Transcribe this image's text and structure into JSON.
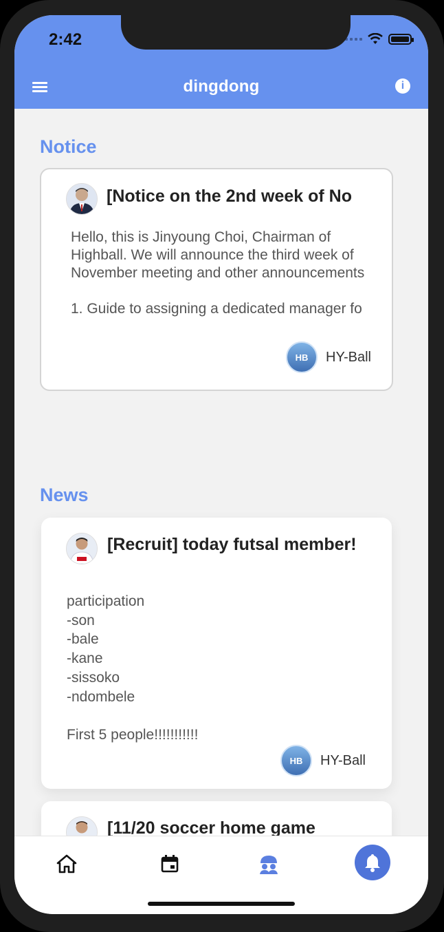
{
  "status_bar": {
    "time": "2:42"
  },
  "header": {
    "title": "dingdong",
    "menu_icon": "menu-icon",
    "info_icon": "info-icon"
  },
  "sections": {
    "notice_title": "Notice",
    "news_title": "News"
  },
  "notice_card": {
    "title": "[Notice on the 2nd week of No",
    "body": "Hello, this is Jinyoung Choi, Chairman of Highball. We will announce the third week of November meeting and other announcements\n\n1. Guide to assigning a dedicated manager fo",
    "author": "HY-Ball"
  },
  "news_cards": [
    {
      "title": "[Recruit] today futsal member!",
      "body": "participation\n-son\n-bale\n-kane\n-sissoko\n-ndombele\n\nFirst 5 people!!!!!!!!!!!",
      "author": "HY-Ball"
    },
    {
      "title": "[11/20 soccer home game"
    }
  ],
  "tabs": [
    {
      "icon": "home-icon"
    },
    {
      "icon": "calendar-icon"
    },
    {
      "icon": "team-icon"
    },
    {
      "icon": "bell-icon"
    }
  ],
  "colors": {
    "accent": "#6691ee",
    "background": "#f2f2f2"
  }
}
